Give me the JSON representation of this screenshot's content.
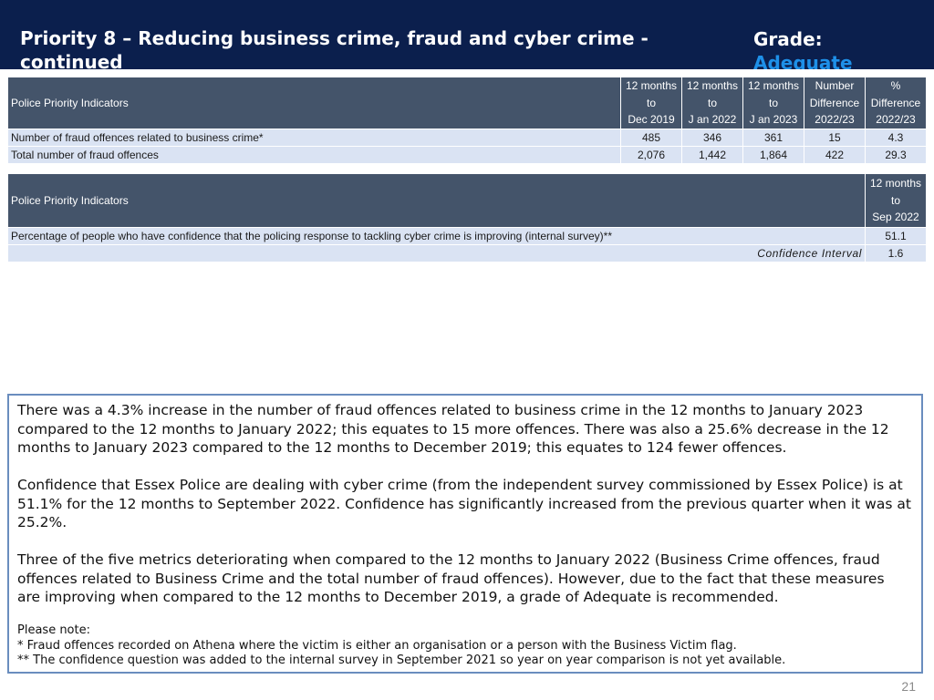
{
  "header": {
    "title": "Priority 8 – Reducing business crime, fraud and cyber crime - continued",
    "grade_label": "Grade:",
    "grade_value": "Adequate",
    "background_color": "#0b1f4d",
    "grade_color": "#1e90e8"
  },
  "table1": {
    "headers": [
      "Police Priority Indicators",
      "12 months to Dec 2019",
      "12 months to J an 2022",
      "12 months to J an 2023",
      "Number Difference 2022/23",
      "% Difference 2022/23"
    ],
    "header_lines": [
      [
        "12 months",
        "to",
        "Dec 2019"
      ],
      [
        "12 months",
        "to",
        "J an 2022"
      ],
      [
        "12 months",
        "to",
        "J an 2023"
      ],
      [
        "Number",
        "Difference",
        "2022/23"
      ],
      [
        "%",
        "Difference",
        "2022/23"
      ]
    ],
    "rows": [
      {
        "label": "Number of fraud offences related to business crime*",
        "values": [
          "485",
          "346",
          "361",
          "15",
          "4.3"
        ]
      },
      {
        "label": "Total number of fraud offences",
        "values": [
          "2,076",
          "1,442",
          "1,864",
          "422",
          "29.3"
        ]
      }
    ]
  },
  "table2": {
    "header_label": "Police Priority Indicators",
    "header_lines": [
      "12 months",
      "to",
      "Sep 2022"
    ],
    "rows": [
      {
        "label": "Percentage of people who have confidence that the policing response to tackling cyber crime is improving (internal survey)**",
        "value": "51.1"
      }
    ],
    "ci_label": "Confidence Interval",
    "ci_value": "1.6"
  },
  "commentary": {
    "para1": "There was a 4.3% increase in the number of fraud offences related to business crime in the 12 months to January 2023 compared to the 12 months to January 2022; this equates to 15 more offences. There was also a 25.6% decrease in the 12 months to January 2023 compared to the 12 months to December 2019; this equates to 124 fewer offences.",
    "para2": "Confidence that Essex Police are dealing with cyber crime (from the independent survey commissioned by Essex Police) is at 51.1% for the 12 months to September 2022. Confidence has significantly increased from the previous quarter when it was at 25.2%.",
    "para3": "Three of the five metrics deteriorating when compared to the 12 months to January 2022 (Business Crime offences, fraud offences related to Business Crime and the total number of fraud offences). However, due to the fact that these measures are improving when compared to the 12 months to December 2019, a grade of Adequate is recommended.",
    "note_heading": "Please note:",
    "note1": "*   Fraud offences recorded on Athena where the victim is either an organisation or a person with the Business Victim flag.",
    "note2": "** The confidence question was added to the internal survey in September 2021 so year on year comparison is not yet available."
  },
  "page_number": "21"
}
